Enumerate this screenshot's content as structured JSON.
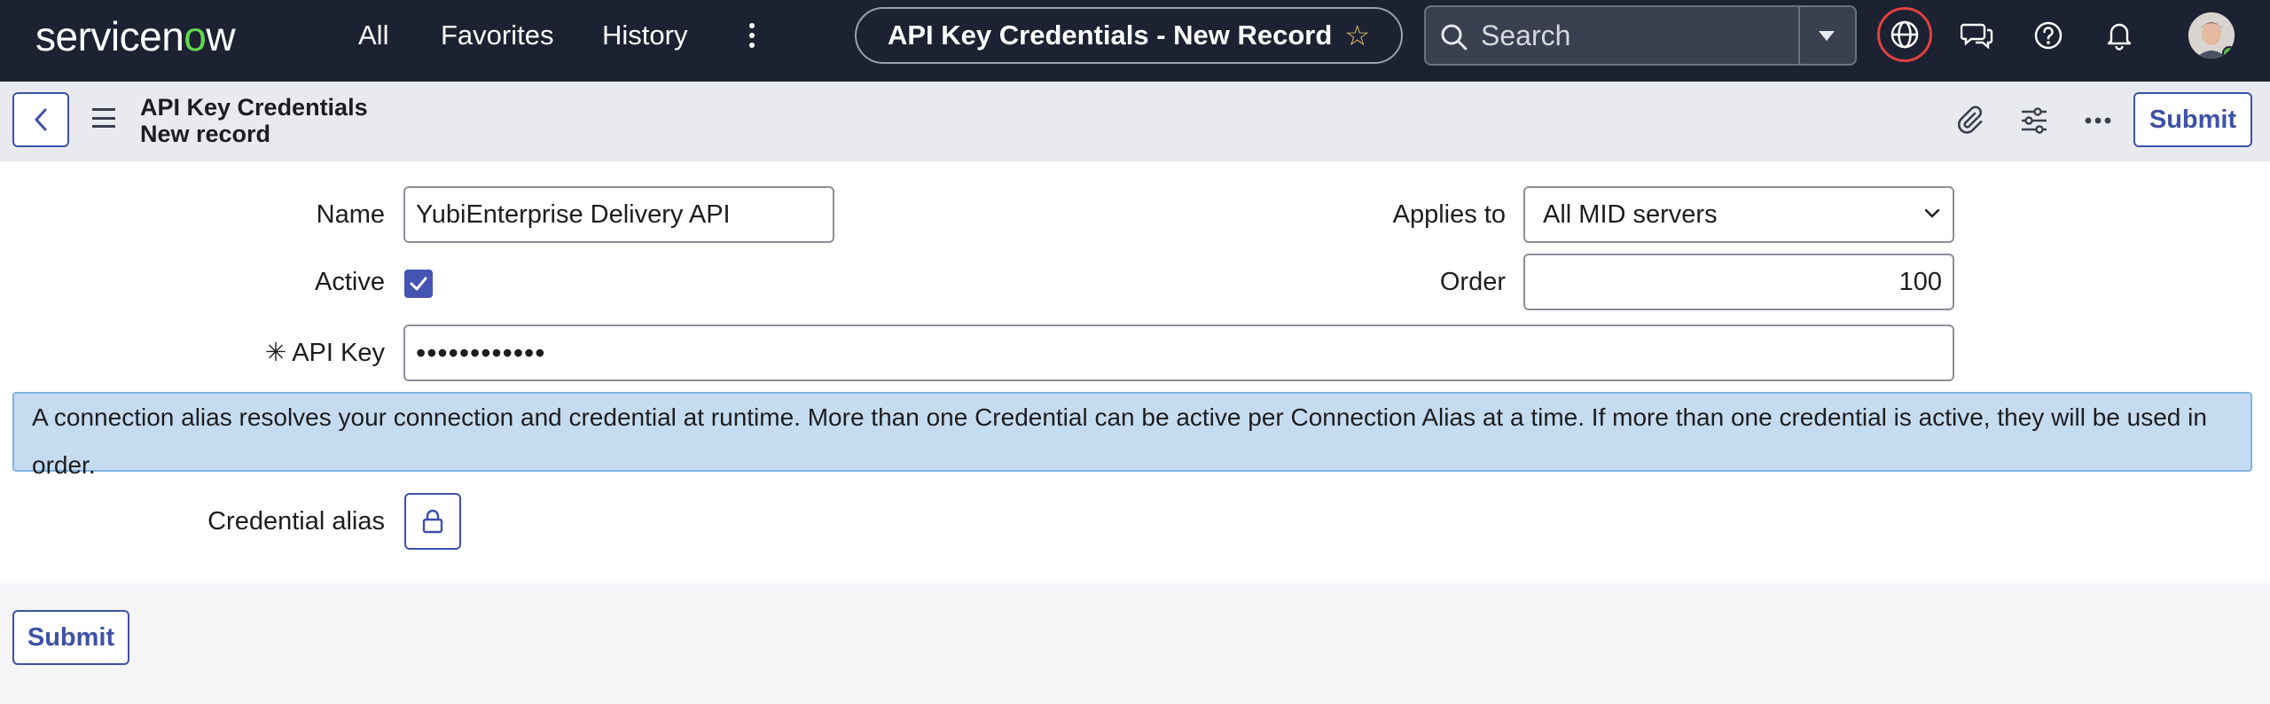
{
  "nav": {
    "logo_pre": "servicen",
    "logo_o": "o",
    "logo_post": "w",
    "links": [
      "All",
      "Favorites",
      "History"
    ],
    "record_title": "API Key Credentials - New Record",
    "search_placeholder": "Search"
  },
  "header": {
    "title_line1": "API Key Credentials",
    "title_line2": "New record",
    "submit_label": "Submit"
  },
  "form": {
    "name_label": "Name",
    "name_value": "YubiEnterprise Delivery API",
    "active_label": "Active",
    "active_checked": true,
    "api_key_label": "API Key",
    "api_key_required_mark": "✳",
    "api_key_value": "••••••••••••",
    "applies_to_label": "Applies to",
    "applies_to_value": "All MID servers",
    "order_label": "Order",
    "order_value": "100",
    "info_text": "A connection alias resolves your connection and credential at runtime. More than one Credential can be active per Connection Alias at a time. If more than one credential is active, they will be used in order.",
    "credential_alias_label": "Credential alias"
  },
  "footer": {
    "submit_label": "Submit"
  },
  "colors": {
    "nav_bg": "#1c2232",
    "accent": "#3f51a6",
    "logo_o": "#62d84e",
    "info_bg": "#c5dcf0",
    "globe_ring": "#e3403f"
  }
}
